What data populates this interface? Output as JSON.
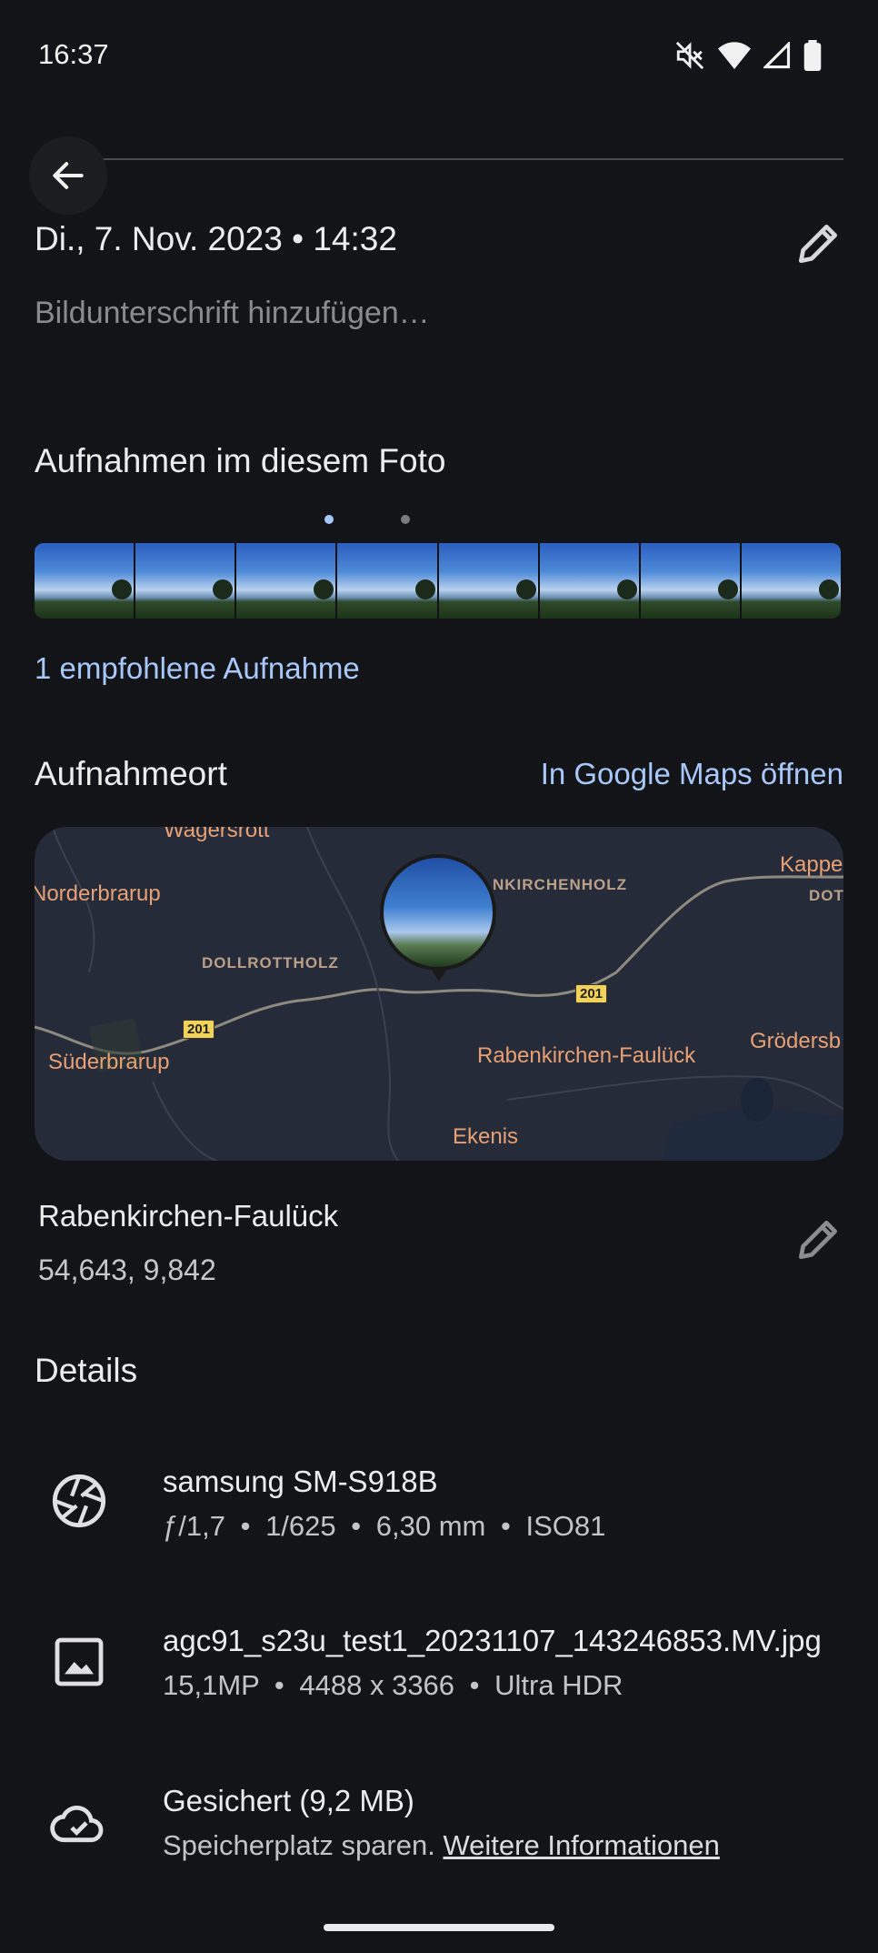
{
  "status_bar": {
    "time": "16:37"
  },
  "header": {
    "date_time": "Di., 7. Nov. 2023 • 14:32",
    "caption_placeholder": "Bildunterschrift hinzufügen…"
  },
  "shots": {
    "title": "Aufnahmen im diesem Foto",
    "page_indicator": {
      "count": 2,
      "active": 1
    },
    "frame_count": 8,
    "recommended_link": "1 empfohlene Aufnahme"
  },
  "location": {
    "title": "Aufnahmeort",
    "maps_link": "In Google Maps öffnen",
    "map_labels": {
      "wagersrott": "Wagersrott",
      "norderbrarup": "Norderbrarup",
      "dollrottholz": "DOLLROTTHOLZ",
      "kirchenholz": "NKIRCHENHOLZ",
      "kappeln": "Kappe",
      "dot": "DOT",
      "suderbrarup": "Süderbrarup",
      "rabenkirchen": "Rabenkirchen-Faulück",
      "grodersby": "Grödersb",
      "ekenis": "Ekenis",
      "road_201_a": "201",
      "road_201_b": "201"
    },
    "place_name": "Rabenkirchen-Faulück",
    "coordinates": "54,643, 9,842"
  },
  "details": {
    "title": "Details",
    "camera": {
      "model": "samsung SM-S918B",
      "aperture": "ƒ/1,7",
      "shutter": "1/625",
      "focal": "6,30 mm",
      "iso": "ISO81",
      "sep": "•"
    },
    "file": {
      "name": "agc91_s23u_test1_20231107_143246853.MV.jpg",
      "resolution": "15,1MP",
      "dimensions": "4488 x 3366",
      "hdr": "Ultra HDR",
      "sep": "•"
    },
    "backup": {
      "status": "Gesichert (9,2 MB)",
      "hint": "Speicherplatz sparen.",
      "more_link": "Weitere Informationen"
    }
  },
  "colors": {
    "background": "#131418",
    "accent": "#a8c7fa",
    "map_label": "#e8a074"
  }
}
